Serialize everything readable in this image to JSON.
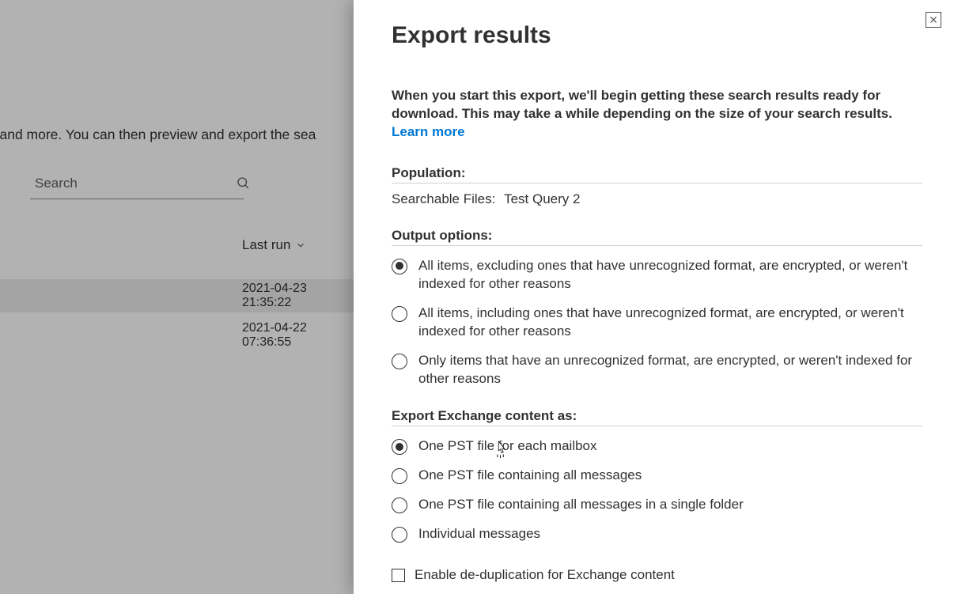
{
  "background": {
    "description_fragment": "versations, and more. You can then preview and export the sea",
    "search_placeholder": "Search",
    "column_header": "Last run",
    "rows": [
      {
        "last_run": "2021-04-23 21:35:22"
      },
      {
        "last_run": "2021-04-22 07:36:55"
      }
    ]
  },
  "panel": {
    "title": "Export results",
    "intro_text": "When you start this export, we'll begin getting these search results ready for download. This may take a while depending on the size of your search results.",
    "learn_more": "Learn more",
    "population_label": "Population:",
    "population_key": "Searchable Files:",
    "population_value": "Test Query 2",
    "output_label": "Output options:",
    "output_options": {
      "opt1": "All items, excluding ones that have unrecognized format, are encrypted, or weren't indexed for other reasons",
      "opt2": "All items, including ones that have unrecognized format, are encrypted, or weren't indexed for other reasons",
      "opt3": "Only items that have an unrecognized format, are encrypted, or weren't indexed for other reasons"
    },
    "export_as_label": "Export Exchange content as:",
    "export_as_options": {
      "e1": "One PST file for each mailbox",
      "e2": "One PST file containing all messages",
      "e3": "One PST file containing all messages in a single folder",
      "e4": "Individual messages"
    },
    "dedup_label": "Enable de-duplication for Exchange content"
  }
}
